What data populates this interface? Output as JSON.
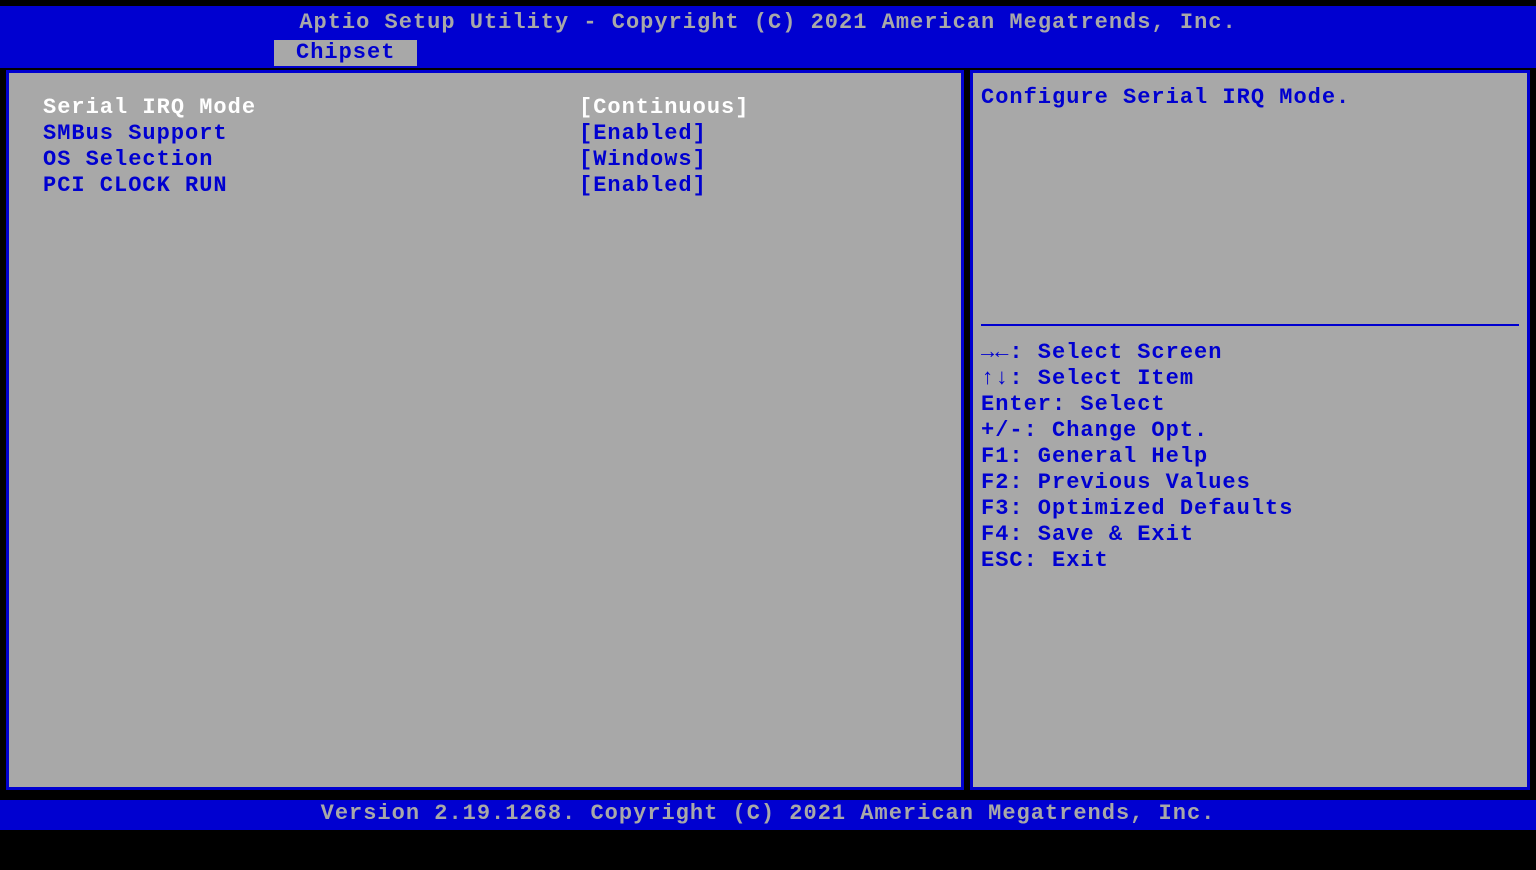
{
  "header": {
    "title": "Aptio Setup Utility - Copyright (C) 2021 American Megatrends, Inc."
  },
  "tabs": [
    {
      "label": "Chipset",
      "active": true
    }
  ],
  "settings": [
    {
      "label": "Serial IRQ Mode",
      "value": "[Continuous]",
      "selected": true
    },
    {
      "label": "SMBus Support",
      "value": "[Enabled]",
      "selected": false
    },
    {
      "label": "OS Selection",
      "value": "[Windows]",
      "selected": false
    },
    {
      "label": "PCI CLOCK RUN",
      "value": "[Enabled]",
      "selected": false
    }
  ],
  "help": {
    "text": "Configure Serial IRQ Mode."
  },
  "hotkeys": [
    {
      "text": "→←: Select Screen"
    },
    {
      "text": "↑↓: Select Item"
    },
    {
      "text": "Enter: Select"
    },
    {
      "text": "+/-: Change Opt."
    },
    {
      "text": "F1: General Help"
    },
    {
      "text": "F2: Previous Values"
    },
    {
      "text": "F3: Optimized Defaults"
    },
    {
      "text": "F4: Save & Exit"
    },
    {
      "text": "ESC: Exit"
    }
  ],
  "footer": {
    "version": "Version 2.19.1268. Copyright (C) 2021 American Megatrends, Inc."
  }
}
